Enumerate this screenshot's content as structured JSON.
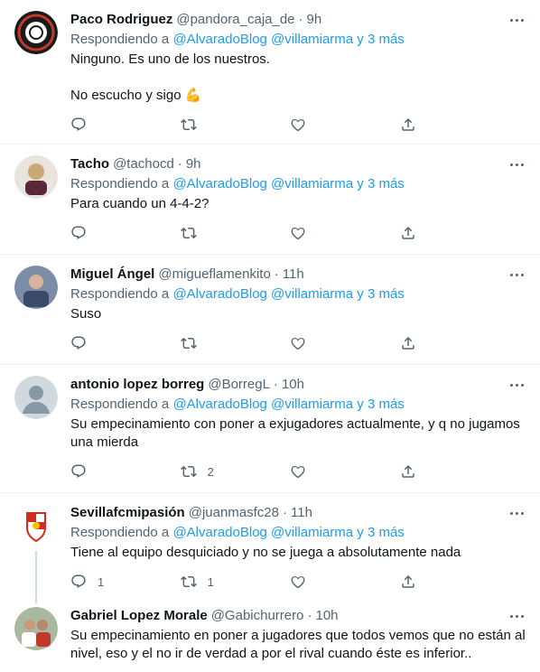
{
  "colors": {
    "link": "#1d9bf0",
    "secondary": "#536471",
    "text": "#0f1419",
    "divider": "#eff3f4",
    "thread": "#cfd9de"
  },
  "tweets": [
    {
      "name": "Paco Rodriguez",
      "handle": "@pandora_caja_de",
      "time": "9h",
      "reply_prefix": "Respondiendo a",
      "mentions": "@AlvaradoBlog @villamiarma y 3 más",
      "lines": [
        "Ninguno. Es uno de los nuestros.",
        "",
        "No escucho y sigo 💪"
      ],
      "replies": "",
      "retweets": "",
      "likes": ""
    },
    {
      "name": "Tacho",
      "handle": "@tachocd",
      "time": "9h",
      "reply_prefix": "Respondiendo a",
      "mentions": "@AlvaradoBlog @villamiarma y 3 más",
      "lines": [
        "Para cuando un 4-4-2?"
      ],
      "replies": "",
      "retweets": "",
      "likes": ""
    },
    {
      "name": "Miguel Ángel",
      "handle": "@migueflamenkito",
      "time": "11h",
      "reply_prefix": "Respondiendo a",
      "mentions": "@AlvaradoBlog @villamiarma y 3 más",
      "lines": [
        "Suso"
      ],
      "replies": "",
      "retweets": "",
      "likes": ""
    },
    {
      "name": "antonio lopez borreg",
      "handle": "@BorregL",
      "time": "10h",
      "reply_prefix": "Respondiendo a",
      "mentions": "@AlvaradoBlog @villamiarma y 3 más",
      "lines": [
        "Su empecinamiento con poner a exjugadores actualmente, y q no jugamos",
        "una mierda"
      ],
      "replies": "",
      "retweets": "2",
      "likes": ""
    },
    {
      "name": "Sevillafcmipasión",
      "handle": "@juanmasfc28",
      "time": "11h",
      "reply_prefix": "Respondiendo a",
      "mentions": "@AlvaradoBlog @villamiarma y 3 más",
      "lines": [
        "Tiene al equipo desquiciado y no se juega a absolutamente nada"
      ],
      "replies": "1",
      "retweets": "1",
      "likes": ""
    },
    {
      "name": "Gabriel Lopez Morale",
      "handle": "@Gabichurrero",
      "time": "10h",
      "reply_prefix": "",
      "mentions": "",
      "lines": [
        "Su empecinamiento en poner a jugadores que todos vemos que no están al",
        "nivel, eso y el no ir de verdad a por el rival cuando éste es inferior.."
      ],
      "replies": "",
      "retweets": "",
      "likes": ""
    }
  ]
}
